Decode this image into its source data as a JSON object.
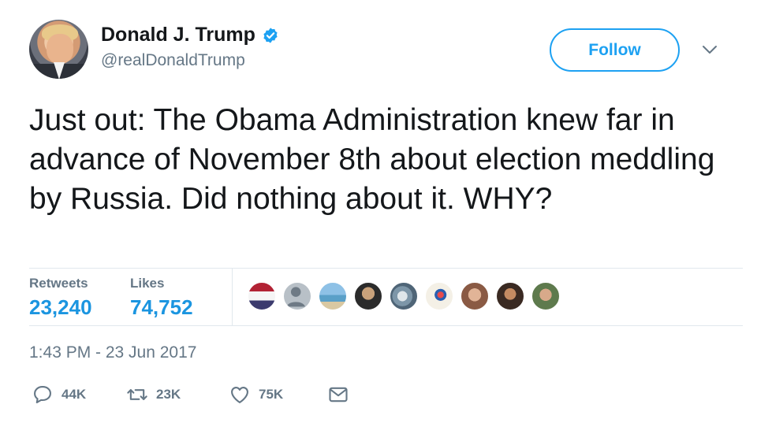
{
  "user": {
    "display_name": "Donald J. Trump",
    "handle": "@realDonaldTrump",
    "verified": true
  },
  "header": {
    "follow_label": "Follow"
  },
  "tweet": {
    "text": "Just out: The Obama Administration knew far in advance of November 8th about election meddling by Russia. Did nothing about it. WHY?"
  },
  "stats": {
    "retweets_label": "Retweets",
    "retweets_value": "23,240",
    "likes_label": "Likes",
    "likes_value": "74,752"
  },
  "timestamp": "1:43 PM - 23 Jun 2017",
  "actions": {
    "reply_count": "44K",
    "retweet_count": "23K",
    "like_count": "75K"
  },
  "colors": {
    "accent": "#1da1f2",
    "link": "#1b95e0",
    "muted": "#657786",
    "border": "#e1e8ed"
  }
}
